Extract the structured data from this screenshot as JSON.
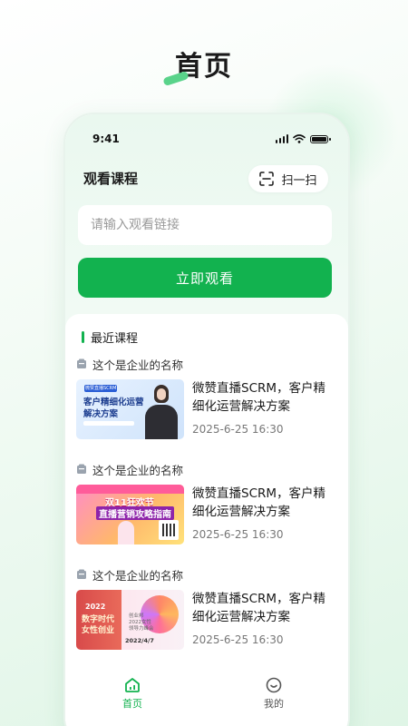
{
  "page_heading": "首页",
  "status": {
    "time": "9:41"
  },
  "watch": {
    "title": "观看课程",
    "scan_label": "扫一扫",
    "input_placeholder": "请输入观看链接",
    "submit_label": "立即观看"
  },
  "recent": {
    "title": "最近课程",
    "courses": [
      {
        "company": "这个是企业的名称",
        "title": "微赞直播SCRM，客户精细化运营解决方案",
        "time": "2025-6-25 16:30",
        "thumb": {
          "tag": "微赞直播SCRM",
          "line1": "客户精细化运营",
          "line2": "解决方案"
        }
      },
      {
        "company": "这个是企业的名称",
        "title": "微赞直播SCRM，客户精细化运营解决方案",
        "time": "2025-6-25 16:30",
        "thumb": {
          "line1": "双11狂欢节",
          "line2": "直播营销攻略指南"
        }
      },
      {
        "company": "这个是企业的名称",
        "title": "微赞直播SCRM，客户精细化运营解决方案",
        "time": "2025-6-25 16:30",
        "thumb": {
          "year": "2022",
          "line1": "数字时代",
          "line2": "女性创业",
          "small": "创业邦 2022女性领导力峰会",
          "date": "2022/4/7"
        }
      }
    ]
  },
  "tabbar": {
    "tabs": [
      {
        "label": "首页",
        "active": true
      },
      {
        "label": "我的",
        "active": false
      }
    ]
  },
  "colors": {
    "accent": "#12b24f",
    "text": "#1a1a1a",
    "muted": "#777777"
  }
}
